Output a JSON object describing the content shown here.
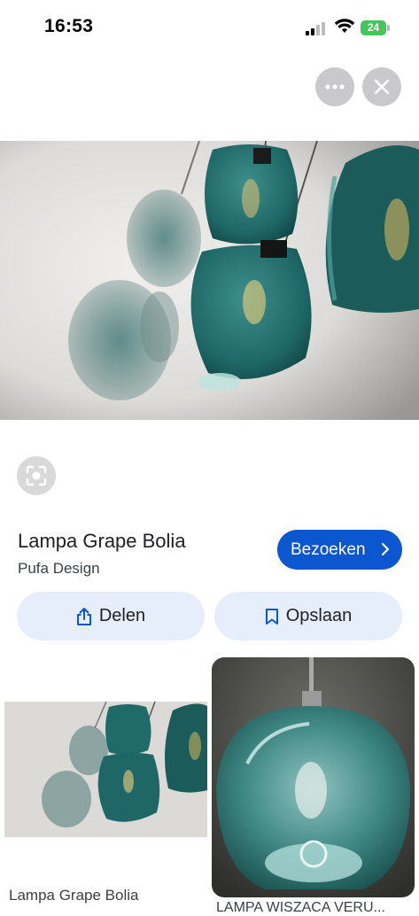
{
  "status_bar": {
    "time": "16:53",
    "battery": "24"
  },
  "result": {
    "title": "Lampa Grape Bolia",
    "source": "Pufa Design",
    "visit_label": "Bezoeken",
    "share_label": "Delen",
    "save_label": "Opslaan"
  },
  "related": [
    {
      "caption": "Lampa Grape Bolia"
    },
    {
      "caption": "LAMPA WISZACA VERU..."
    }
  ],
  "colors": {
    "accent": "#0b57d0",
    "pill_bg": "#e7eefb",
    "glass": "#1f6d6c"
  },
  "icons": [
    "more-icon",
    "close-icon",
    "lens-icon",
    "share-icon",
    "bookmark-icon",
    "chevron-right-icon"
  ]
}
